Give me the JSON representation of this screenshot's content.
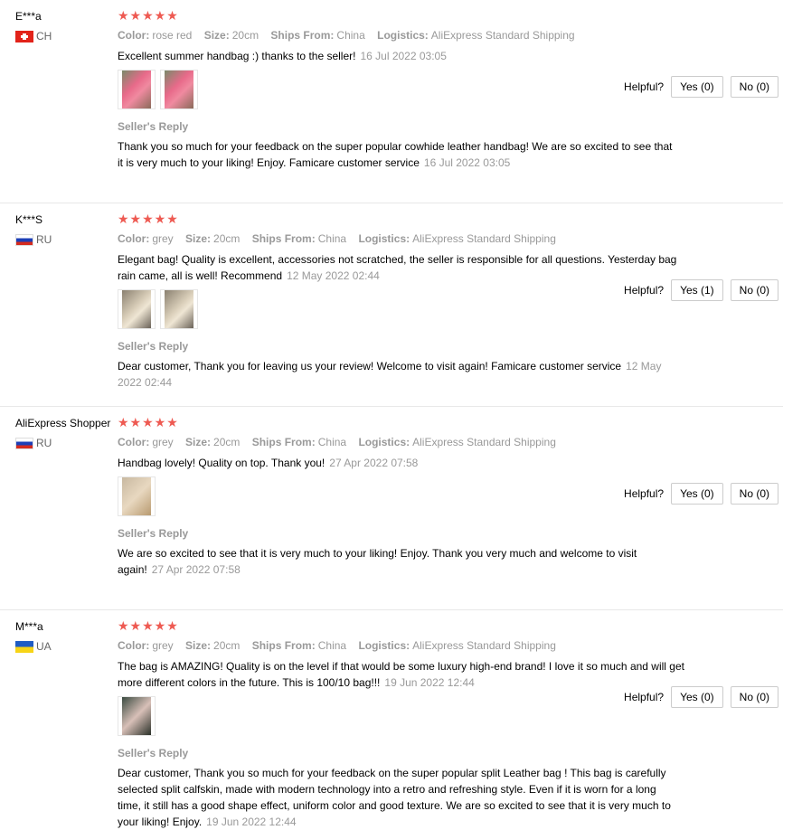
{
  "labels": {
    "color": "Color:",
    "size": "Size:",
    "ships_from": "Ships From:",
    "logistics": "Logistics:",
    "helpful": "Helpful?",
    "sellers_reply": "Seller's Reply",
    "stars": "★★★★★"
  },
  "colors": {
    "star": "#ee5a52",
    "muted": "#999999"
  },
  "reviews": [
    {
      "user": "E***a",
      "country": "CH",
      "flag": "ch",
      "color": "rose red",
      "size": "20cm",
      "ships_from": "China",
      "logistics": "AliExpress Standard Shipping",
      "text": "Excellent summer handbag :) thanks to the seller!",
      "date": "16 Jul 2022 03:05",
      "photos": [
        "pink-bag-photo",
        "pink-bag-photo"
      ],
      "yes": "Yes (0)",
      "no": "No (0)",
      "reply": "Thank you so much for your feedback on the super popular cowhide leather handbag! We are so excited to see that it is very much to your liking! Enjoy. Famicare customer service",
      "reply_date": "16 Jul 2022 03:05"
    },
    {
      "user": "K***S",
      "country": "RU",
      "flag": "ru",
      "color": "grey",
      "size": "20cm",
      "ships_from": "China",
      "logistics": "AliExpress Standard Shipping",
      "text": "Elegant bag! Quality is excellent, accessories not scratched, the seller is responsible for all questions. Yesterday bag rain came, all is well! Recommend",
      "date": "12 May 2022 02:44",
      "photos": [
        "grey-bag-photo",
        "grey-bag-photo"
      ],
      "yes": "Yes (1)",
      "no": "No (0)",
      "reply": "Dear customer, Thank you for leaving us your review! Welcome to visit again! Famicare customer service",
      "reply_date": "12 May 2022 02:44"
    },
    {
      "user": "AliExpress Shopper",
      "country": "RU",
      "flag": "ru",
      "color": "grey",
      "size": "20cm",
      "ships_from": "China",
      "logistics": "AliExpress Standard Shipping",
      "text": "Handbag lovely! Quality on top. Thank you!",
      "date": "27 Apr 2022 07:58",
      "photos": [
        "beige-bag-photo"
      ],
      "yes": "Yes (0)",
      "no": "No (0)",
      "reply": "We are so excited to see that it is very much to your liking! Enjoy. Thank you very much and welcome to visit again!",
      "reply_date": "27 Apr 2022 07:58"
    },
    {
      "user": "M***a",
      "country": "UA",
      "flag": "ua",
      "color": "grey",
      "size": "20cm",
      "ships_from": "China",
      "logistics": "AliExpress Standard Shipping",
      "text": "The bag is AMAZING! Quality is on the level if that would be some luxury high-end brand! I love it so much and will get more different colors in the future. This is 100/10 bag!!!",
      "date": "19 Jun 2022 12:44",
      "photos": [
        "dark-bag-photo"
      ],
      "yes": "Yes (0)",
      "no": "No (0)",
      "reply": "Dear customer, Thank you so much for your feedback on the super popular split Leather bag ! This bag is carefully selected split calfskin, made with modern technology into a retro and refreshing style. Even if it is worn for a long time, it still has a good shape effect, uniform color and good texture. We are so excited to see that it is very much to your liking! Enjoy.",
      "reply_date": "19 Jun 2022 12:44"
    }
  ]
}
